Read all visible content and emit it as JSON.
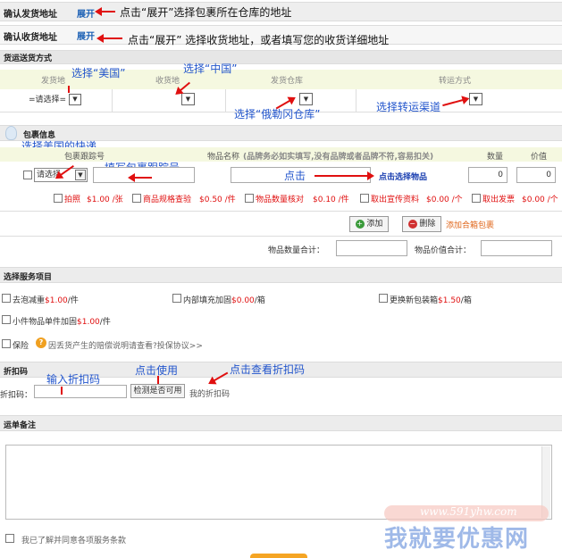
{
  "sender_address": {
    "label": "确认发货地址",
    "expand": "展开",
    "hint": "点击“展开”选择包裹所在仓库的地址"
  },
  "receiver_address": {
    "label": "确认收货地址",
    "expand": "展开",
    "hint": "点击“展开” 选择收货地址，或者填写您的收货详细地址"
  },
  "shipping": {
    "section_title": "货运送货方式",
    "columns": [
      "发货地",
      "收货地",
      "发货仓库",
      "转运方式"
    ],
    "origin_select": "=请选择=",
    "annotations": {
      "origin": "选择“美国”",
      "dest": "选择“中国”",
      "warehouse": "选择“俄勒冈仓库”",
      "method": "选择转运渠道"
    }
  },
  "package": {
    "section_title": "包裹信息",
    "courier_ann": "选择美国的快递",
    "tracking_head": "包裹跟踪号",
    "tracking_ann": "填写包裹跟踪号",
    "item_name_head": "物品名称",
    "item_name_warn": "(品牌务必如实填写,没有品牌或者品牌不符,容易扣关)",
    "qty_head": "数量",
    "value_head": "价值",
    "courier_select": "请选择",
    "click_ann": "点击",
    "select_item": "点击选择物品",
    "qty_value": "0",
    "price_value": "0",
    "services": [
      {
        "name": "拍照",
        "price": "$1.00 /张"
      },
      {
        "name": "商品规格查验",
        "price": "$0.50 /件"
      },
      {
        "name": "物品数量核对",
        "price": "$0.10 /件"
      },
      {
        "name": "取出宣传资料",
        "price": "$0.00 /个"
      },
      {
        "name": "取出发票",
        "price": "$0.00 /个"
      }
    ],
    "add_button": "添加",
    "delete_button": "删除",
    "add_combined": "添加合箱包裹",
    "qty_total": "物品数量合计：",
    "value_total": "物品价值合计："
  },
  "service_items": {
    "section_title": "选择服务项目",
    "items": [
      {
        "name": "去泡减重",
        "price": "$1.00",
        "unit": "/件"
      },
      {
        "name": "内部填充加固",
        "price": "$0.00",
        "unit": "/箱"
      },
      {
        "name": "更换新包装箱",
        "price": "$1.50",
        "unit": "/箱"
      },
      {
        "name": "小件物品单件加固",
        "price": "$1.00",
        "unit": "/件"
      }
    ],
    "insurance": "保险",
    "insurance_note": "因丢货产生的赔偿说明请查看?投保协议>>"
  },
  "discount": {
    "section_title": "折扣码",
    "label": "折扣码：",
    "check_button": "检测是否可用",
    "my_codes": "我的折扣码",
    "ann_input": "输入折扣码",
    "ann_use": "点击使用",
    "ann_view": "点击查看折扣码"
  },
  "notes": {
    "section_title": "运单备注"
  },
  "agree": "我已了解并同意各项服务条款",
  "watermark": {
    "url": "www.591yhw.com",
    "name": "我就要优惠网"
  }
}
